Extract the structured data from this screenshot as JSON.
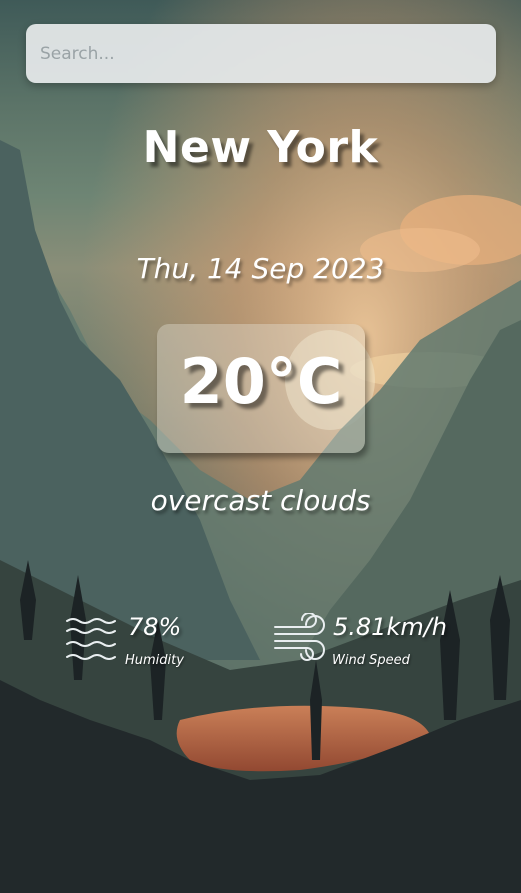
{
  "search": {
    "placeholder": "Search...",
    "value": ""
  },
  "weather": {
    "city": "New York",
    "date": "Thu, 14 Sep 2023",
    "temperature": "20°C",
    "description": "overcast clouds"
  },
  "stats": {
    "humidity": {
      "value": "78%",
      "label": "Humidity",
      "icon": "humidity-waves-icon"
    },
    "wind": {
      "value": "5.81km/h",
      "label": "Wind Speed",
      "icon": "wind-icon"
    }
  },
  "colors": {
    "text": "#ffffff",
    "search_background": "#e6eaeb",
    "sky_glow": "#e8a36a",
    "lake": "#d9734a"
  }
}
